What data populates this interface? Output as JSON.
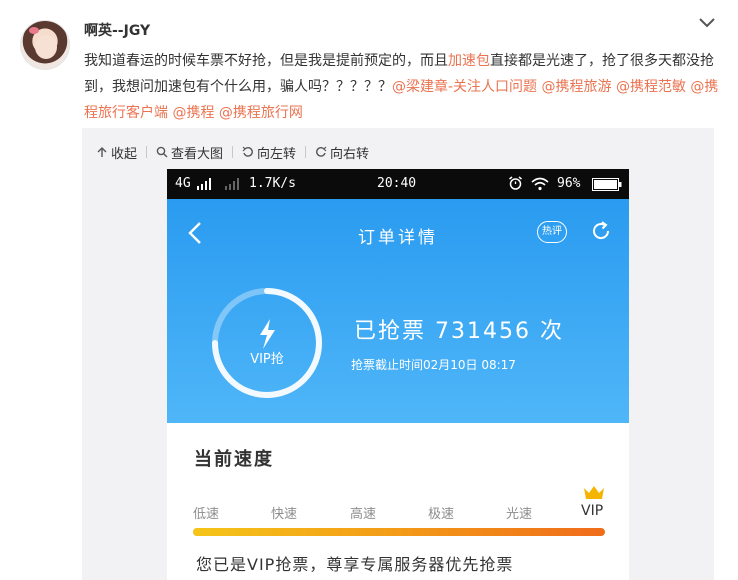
{
  "post": {
    "username": "啊英--JGY",
    "text_before": "我知道春运的时候车票不好抢，但是我是提前预定的，而且",
    "highlight": "加速包",
    "text_after": "直接都是光速了，抢了很多天都没抢到，我想问加速包有个什么用，骗人吗？？？？？",
    "mentions": [
      "@梁建章-关注人口问题",
      "@携程旅游",
      "@携程范敏",
      "@携程旅行客户端",
      "@携程",
      "@携程旅行网"
    ]
  },
  "media_toolbar": {
    "collapse": "收起",
    "view_large": "查看大图",
    "rotate_left": "向左转",
    "rotate_right": "向右转"
  },
  "phone": {
    "status": {
      "network": "4G",
      "speed": "1.7K/s",
      "time": "20:40",
      "battery": "96%"
    },
    "nav_title": "订单详情",
    "hot_label": "热评",
    "vip_label": "VIP抢",
    "grab_count_text": "已抢票 731456 次",
    "deadline_text": "抢票截止时间02月10日 08:17",
    "speed_title": "当前速度",
    "speed_levels": [
      "低速",
      "快速",
      "高速",
      "极速",
      "光速",
      "VIP"
    ],
    "speed_level_fraction": 1.0,
    "vip_note": "您已是VIP抢票，尊享专属服务器优先抢票"
  },
  "colors": {
    "link": "#eb7350",
    "app_blue": "#2a9bf0",
    "speed_bar": "#f39a18"
  }
}
